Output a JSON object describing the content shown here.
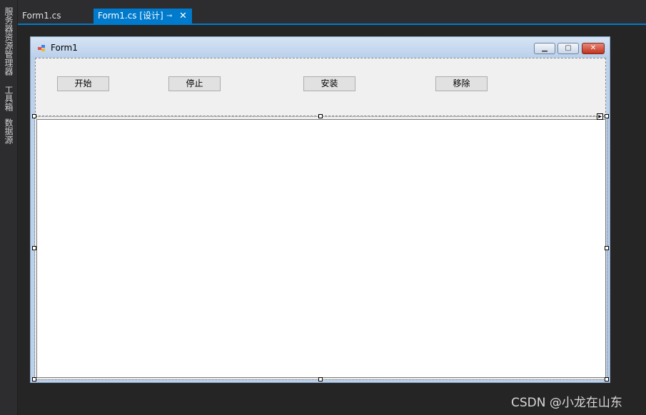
{
  "side_panels": [
    "服务器资源管理器",
    "工具箱",
    "数据源"
  ],
  "tabs": {
    "inactive_label": "Form1.cs",
    "active_label": "Form1.cs [设计]"
  },
  "form": {
    "title": "Form1",
    "buttons": [
      "开始",
      "停止",
      "安装",
      "移除"
    ]
  },
  "watermark": "CSDN @小龙在山东",
  "colors": {
    "accent": "#007acc",
    "editor_bg": "#252526"
  }
}
